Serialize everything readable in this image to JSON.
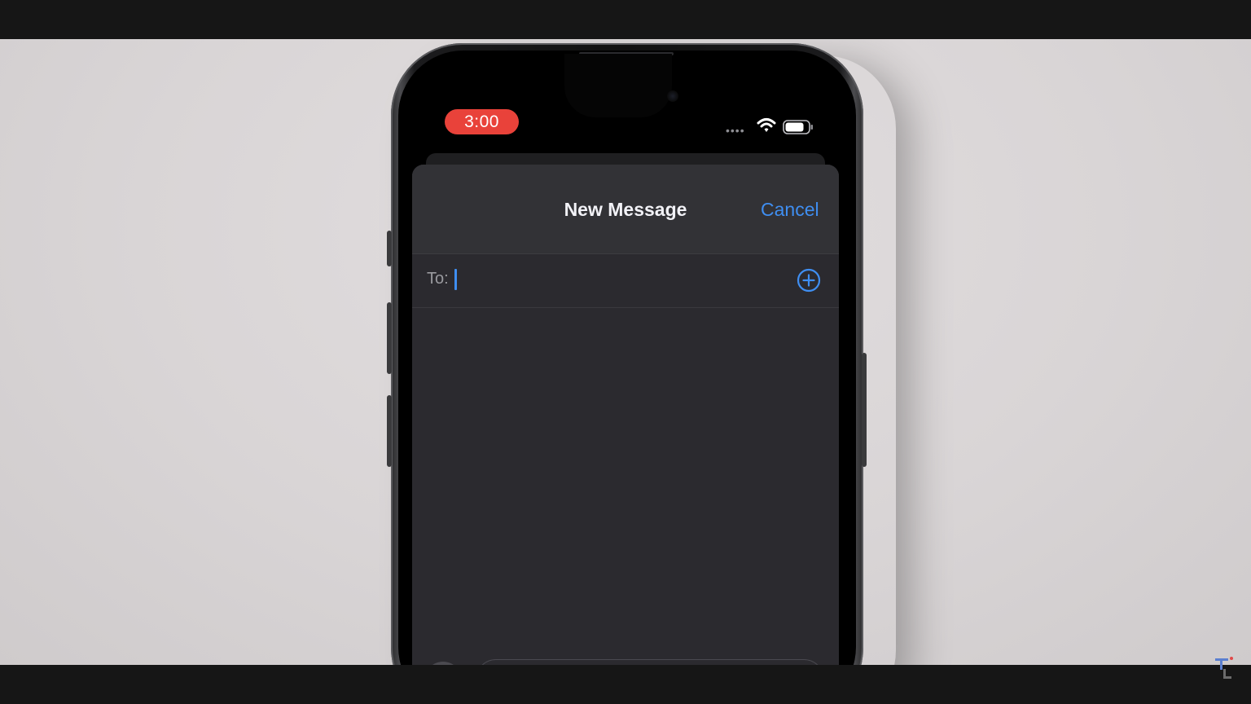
{
  "status_bar": {
    "time": "3:00",
    "pill_color": "#e9423a",
    "signal_icon": "signal-dots-icon",
    "wifi_icon": "wifi-icon",
    "battery_icon": "battery-icon"
  },
  "new_message": {
    "title": "New Message",
    "cancel_label": "Cancel",
    "to_label": "To:",
    "to_value": "",
    "add_contact_icon": "plus-circle-icon",
    "message_value": "",
    "apps_icon": "plus-icon",
    "mic_icon": "microphone-icon"
  },
  "colors": {
    "accent": "#3f8ef1",
    "sheet_background": "#2b2a2f",
    "nav_background": "#323236"
  }
}
